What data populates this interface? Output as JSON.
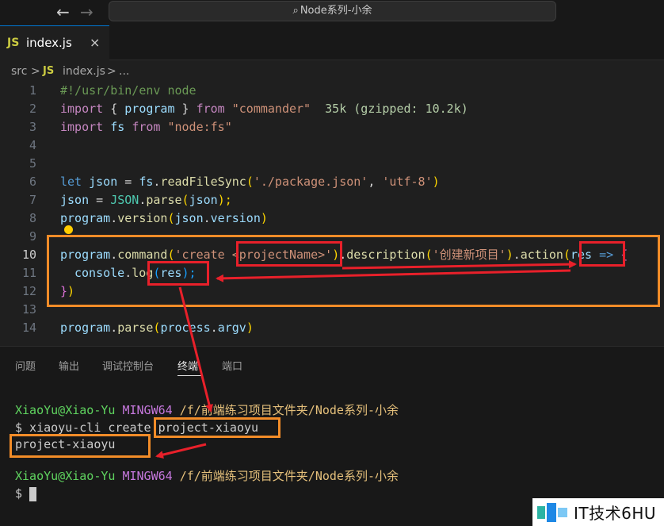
{
  "titlebar": {
    "search_text": "Node系列-小余"
  },
  "tab": {
    "badge": "JS",
    "label": "index.js",
    "close": "×"
  },
  "breadcrumb": {
    "folder": "src",
    "sep": ">",
    "badge": "JS",
    "file": "index.js",
    "more": "..."
  },
  "editor": {
    "current_line": 10,
    "line_numbers": [
      "1",
      "2",
      "3",
      "4",
      "5",
      "6",
      "7",
      "8",
      "9",
      "10",
      "11",
      "12",
      "13",
      "14"
    ],
    "l1": "#!/usr/bin/env node",
    "l2": {
      "k1": "import",
      "p1": " { ",
      "v": "program",
      "p2": " } ",
      "k2": "from",
      "s": "\"commander\"",
      "size": "  35k (gzipped: 10.2k)"
    },
    "l3": {
      "k1": "import",
      "v": " fs ",
      "k2": "from",
      "s": " \"node:fs\""
    },
    "l6": {
      "k": "let",
      "v": " json",
      "o": " = ",
      "obj": "fs",
      "dot": ".",
      "fn": "readFileSync",
      "p1": "(",
      "s1": "'./package.json'",
      "c": ", ",
      "s2": "'utf-8'",
      "p2": ")"
    },
    "l7": {
      "v": "json",
      "o": " = ",
      "cls": "JSON",
      "dot": ".",
      "fn": "parse",
      "p1": "(",
      "arg": "json",
      "p2": ");"
    },
    "l8": {
      "obj": "program",
      "dot": ".",
      "fn": "version",
      "p1": "(",
      "a1": "json",
      "dot2": ".",
      "a2": "version",
      "p2": ")"
    },
    "l10": {
      "obj": "program",
      "dot": ".",
      "fn": "command",
      "p1": "(",
      "s1": "'create <projectName>'",
      "p2": ")",
      "dot2": ".",
      "fn2": "description",
      "p3": "(",
      "s2": "'创建新项目'",
      "p4": ")",
      "dot3": ".",
      "fn3": "action",
      "p5": "(",
      "arg": "res",
      "arrow": " => ",
      "br": "{"
    },
    "l11": {
      "obj": "console",
      "dot": ".",
      "fn": "log",
      "p1": "(",
      "arg": "res",
      "p2": ");"
    },
    "l12": {
      "br": "}",
      "p": ")"
    },
    "l14": {
      "obj": "program",
      "dot": ".",
      "fn": "parse",
      "p1": "(",
      "a1": "process",
      "dot2": ".",
      "a2": "argv",
      "p2": ")"
    }
  },
  "panel": {
    "tabs": [
      "问题",
      "输出",
      "调试控制台",
      "终端",
      "端口"
    ],
    "active_tab": "终端"
  },
  "terminal": {
    "prompt1": {
      "user": "XiaoYu@Xiao-Yu",
      "host": " MINGW64",
      "path": " /f/前端练习项目文件夹/Node系列-小余"
    },
    "cmd": "$ xiaoyu-cli create project-xiaoyu",
    "output": "project-xiaoyu",
    "prompt2": {
      "user": "XiaoYu@Xiao-Yu",
      "host": " MINGW64",
      "path": " /f/前端练习项目文件夹/Node系列-小余"
    },
    "dollar": "$ "
  },
  "watermark": {
    "text": "IT技术6HU"
  },
  "colors": {
    "annotation_orange": "#f28c28",
    "annotation_red": "#e8202a",
    "accent": "#0078d4"
  }
}
